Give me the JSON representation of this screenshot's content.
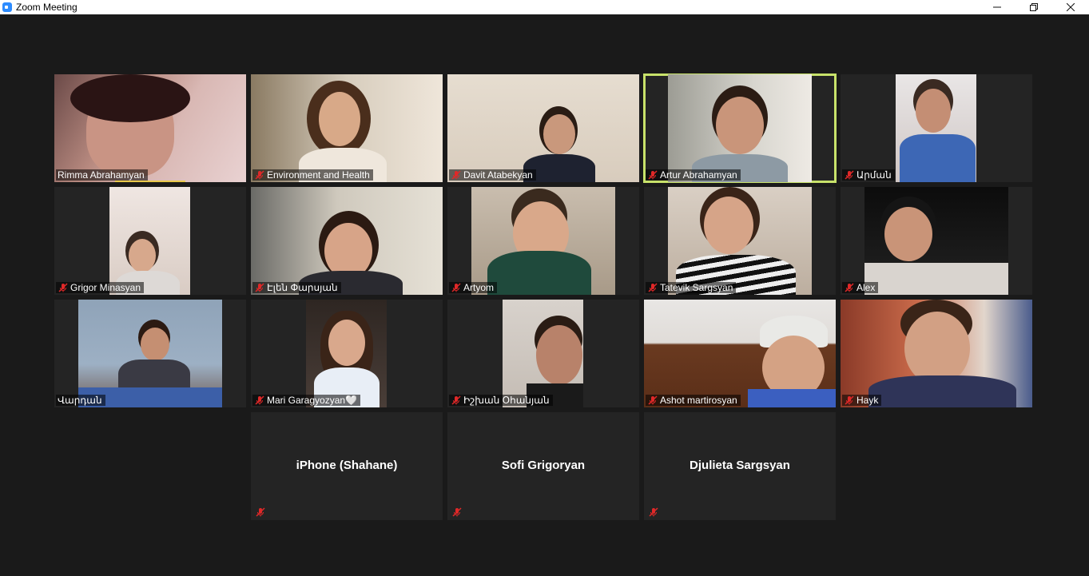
{
  "window": {
    "title": "Zoom Meeting",
    "controls": [
      "minimize",
      "restore",
      "close"
    ]
  },
  "participants": [
    {
      "name": "Rimma Abrahamyan",
      "muted": false,
      "video": true,
      "speaking": true
    },
    {
      "name": "Environment and Health",
      "muted": true,
      "video": true
    },
    {
      "name": "Davit Atabekyan",
      "muted": true,
      "video": true
    },
    {
      "name": "Artur Abrahamyan",
      "muted": true,
      "video": true,
      "active": true
    },
    {
      "name": "Արման",
      "muted": true,
      "video": true
    },
    {
      "name": "Grigor Minasyan",
      "muted": true,
      "video": true
    },
    {
      "name": "Էլեն Փարսյան",
      "muted": true,
      "video": true
    },
    {
      "name": "Artyom",
      "muted": true,
      "video": true
    },
    {
      "name": "Tatevik Sargsyan",
      "muted": true,
      "video": true
    },
    {
      "name": "Alex",
      "muted": true,
      "video": true
    },
    {
      "name": "Վարդան",
      "muted": false,
      "video": true
    },
    {
      "name": "Mari Garagyozyan🤍",
      "muted": true,
      "video": true
    },
    {
      "name": "Իշխան Օհանյան",
      "muted": true,
      "video": true
    },
    {
      "name": "Ashot martirosyan",
      "muted": true,
      "video": true
    },
    {
      "name": "Hayk",
      "muted": true,
      "video": true
    },
    {
      "name": "iPhone (Shahane)",
      "muted": true,
      "video": false
    },
    {
      "name": "Sofi Grigoryan",
      "muted": true,
      "video": false
    },
    {
      "name": "Djulieta Sargsyan",
      "muted": true,
      "video": false
    }
  ],
  "colors": {
    "background": "#1a1a1a",
    "tile": "#242424",
    "active_border": "#c8e26a",
    "muted_icon": "#e02828"
  }
}
